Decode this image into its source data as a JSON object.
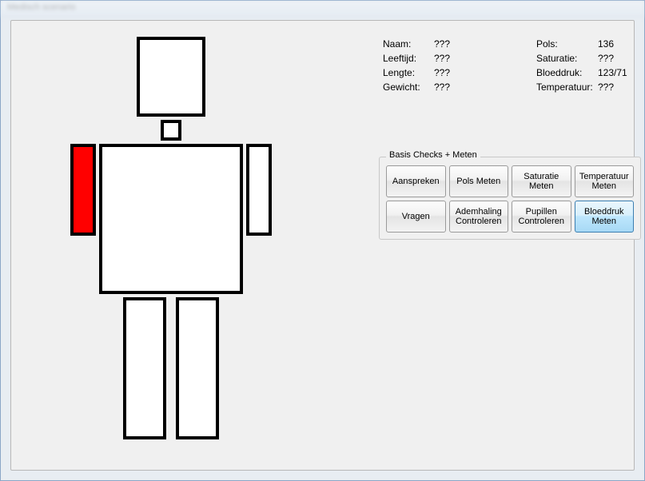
{
  "window": {
    "title": "Medisch scenario"
  },
  "patient": {
    "labels": {
      "naam": "Naam:",
      "leeftijd": "Leeftijd:",
      "lengte": "Lengte:",
      "gewicht": "Gewicht:",
      "pols": "Pols:",
      "saturatie": "Saturatie:",
      "bloeddruk": "Bloeddruk:",
      "temperatuur": "Temperatuur:"
    },
    "values": {
      "naam": "???",
      "leeftijd": "???",
      "lengte": "???",
      "gewicht": "???",
      "pols": "136",
      "saturatie": "???",
      "bloeddruk": "123/71",
      "temperatuur": "???"
    }
  },
  "group": {
    "title": "Basis Checks + Meten",
    "buttons": {
      "aanspreken": "Aanspreken",
      "pols_meten": "Pols Meten",
      "saturatie_meten": "Saturatie\nMeten",
      "temperatuur_meten": "Temperatuur\nMeten",
      "vragen": "Vragen",
      "ademhaling_controleren": "Ademhaling\nControleren",
      "pupillen_controleren": "Pupillen\nControleren",
      "bloeddruk_meten": "Bloeddruk\nMeten"
    }
  },
  "body_parts": {
    "head": {
      "highlighted": false
    },
    "neck": {
      "highlighted": false
    },
    "torso": {
      "highlighted": false
    },
    "upper_arm_right_patient": {
      "highlighted": true
    },
    "upper_arm_left_patient": {
      "highlighted": false
    },
    "leg_right_patient": {
      "highlighted": false
    },
    "leg_left_patient": {
      "highlighted": false
    }
  },
  "colors": {
    "highlight": "#ff0000"
  }
}
